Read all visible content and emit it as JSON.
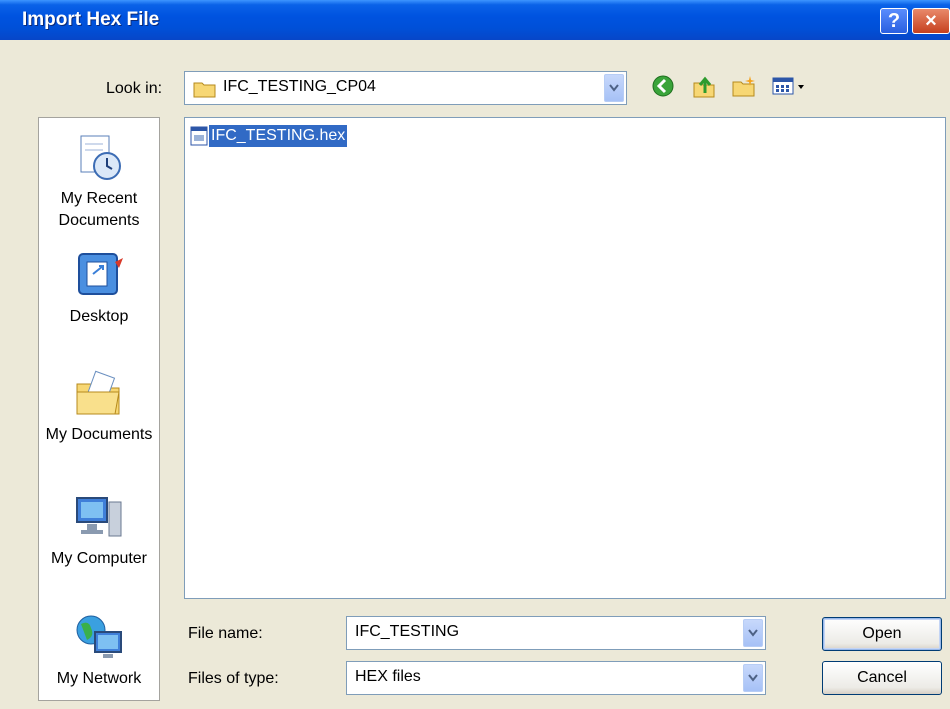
{
  "window": {
    "title": "Import Hex File",
    "help_glyph": "?",
    "close_glyph": "×"
  },
  "look_in": {
    "label": "Look in:",
    "value": "IFC_TESTING_CP04",
    "icon": "folder-icon"
  },
  "toolbar": {
    "icons": [
      "back-icon",
      "up-folder-icon",
      "new-folder-icon",
      "view-menu-icon"
    ]
  },
  "places": [
    {
      "label_line1": "My Recent",
      "label_line2": "Documents",
      "icon": "recent-documents-icon"
    },
    {
      "label_line1": "Desktop",
      "label_line2": "",
      "icon": "desktop-icon"
    },
    {
      "label_line1": "My Documents",
      "label_line2": "",
      "icon": "my-documents-icon"
    },
    {
      "label_line1": "My Computer",
      "label_line2": "",
      "icon": "my-computer-icon"
    },
    {
      "label_line1": "My Network",
      "label_line2": "",
      "icon": "my-network-icon"
    }
  ],
  "files": [
    {
      "name": "IFC_TESTING.hex",
      "selected": true,
      "icon": "hex-file-icon"
    }
  ],
  "file_name": {
    "label": "File name:",
    "value": "IFC_TESTING"
  },
  "file_type": {
    "label": "Files of type:",
    "value": "HEX files"
  },
  "buttons": {
    "open": "Open",
    "cancel": "Cancel"
  },
  "colors": {
    "titlebar": "#0053e0",
    "selection": "#316ac5",
    "dialog_bg": "#ece9d8"
  }
}
